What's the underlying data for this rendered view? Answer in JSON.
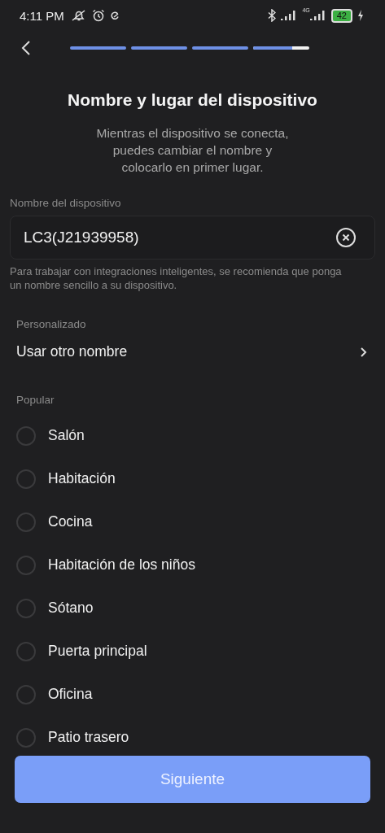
{
  "status_bar": {
    "time": "4:11 PM",
    "network": "4G",
    "battery": "42"
  },
  "progress": [
    {
      "level": 1
    },
    {
      "level": 1
    },
    {
      "level": 1
    },
    {
      "level": 0.7
    }
  ],
  "title": "Nombre y lugar del dispositivo",
  "subtitle": "Mientras el dispositivo se conecta, puedes cambiar el nombre y colocarlo en primer lugar.",
  "name_field": {
    "label": "Nombre del dispositivo",
    "value": "LC3(J21939958)",
    "hint": "Para trabajar con integraciones inteligentes, se recomienda que ponga un nombre sencillo a su dispositivo."
  },
  "custom": {
    "heading": "Personalizado",
    "label": "Usar otro nombre"
  },
  "popular": {
    "heading": "Popular",
    "options": [
      {
        "label": "Salón",
        "selected": false
      },
      {
        "label": "Habitación",
        "selected": false
      },
      {
        "label": "Cocina",
        "selected": false
      },
      {
        "label": "Habitación de los niños",
        "selected": false
      },
      {
        "label": "Sótano",
        "selected": false
      },
      {
        "label": "Puerta principal",
        "selected": false
      },
      {
        "label": "Oficina",
        "selected": false
      },
      {
        "label": "Patio trasero",
        "selected": false
      }
    ]
  },
  "next_button": "Siguiente"
}
